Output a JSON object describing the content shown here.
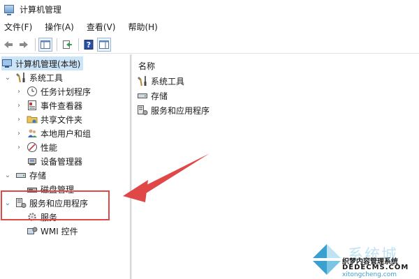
{
  "window": {
    "title": "计算机管理"
  },
  "menubar": {
    "items": [
      "文件(F)",
      "操作(A)",
      "查看(V)",
      "帮助(H)"
    ]
  },
  "toolbar": {
    "buttons": [
      "back-arrow-icon",
      "forward-arrow-icon",
      "show-tree-icon",
      "export-list-icon",
      "help-icon",
      "action-pane-icon"
    ]
  },
  "tree": {
    "root": "计算机管理(本地)",
    "system_tools": {
      "label": "系统工具",
      "children": [
        "任务计划程序",
        "事件查看器",
        "共享文件夹",
        "本地用户和组",
        "性能",
        "设备管理器"
      ]
    },
    "storage": {
      "label": "存储",
      "children": [
        "磁盘管理"
      ]
    },
    "services_apps": {
      "label": "服务和应用程序",
      "children": [
        "服务",
        "WMI 控件"
      ]
    }
  },
  "list": {
    "column_header": "名称",
    "items": [
      "系统工具",
      "存储",
      "服务和应用程序"
    ]
  },
  "watermark": {
    "big": "系统城",
    "line1": "织梦内容管理系统",
    "line2": "DEDECMS.COM",
    "small": "xitongcheng.com"
  },
  "colors": {
    "selection": "#cce4f7",
    "highlight": "#e04848",
    "expander_blue": "#2a8ad8"
  }
}
